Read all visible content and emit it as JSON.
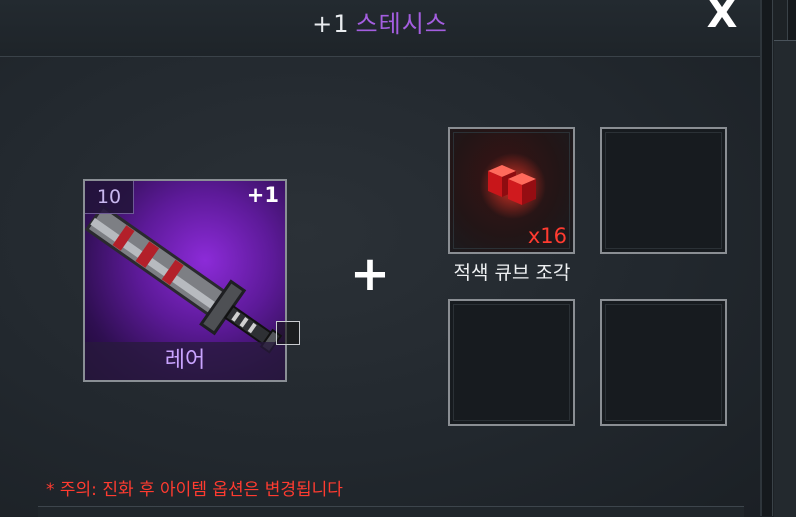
{
  "header": {
    "enhance_level": "+1",
    "item_name": "스테시스",
    "close_label": "X"
  },
  "item": {
    "level": "10",
    "enhance": "+1",
    "rarity": "레어",
    "icon": "sword-icon"
  },
  "combine_symbol": "+",
  "materials": [
    {
      "name": "적색 큐브 조각",
      "count": "x16",
      "icon": "red-cube-icon"
    },
    {
      "name": "",
      "count": "",
      "icon": ""
    },
    {
      "name": "",
      "count": "",
      "icon": ""
    },
    {
      "name": "",
      "count": "",
      "icon": ""
    }
  ],
  "warning": "* 주의: 진화 후 아이템 옵션은 변경됩니다",
  "colors": {
    "item_name": "#a45ee0",
    "rarity_bg": "#6a1fb0",
    "warning": "#ff3b30",
    "count": "#ff3b30"
  }
}
